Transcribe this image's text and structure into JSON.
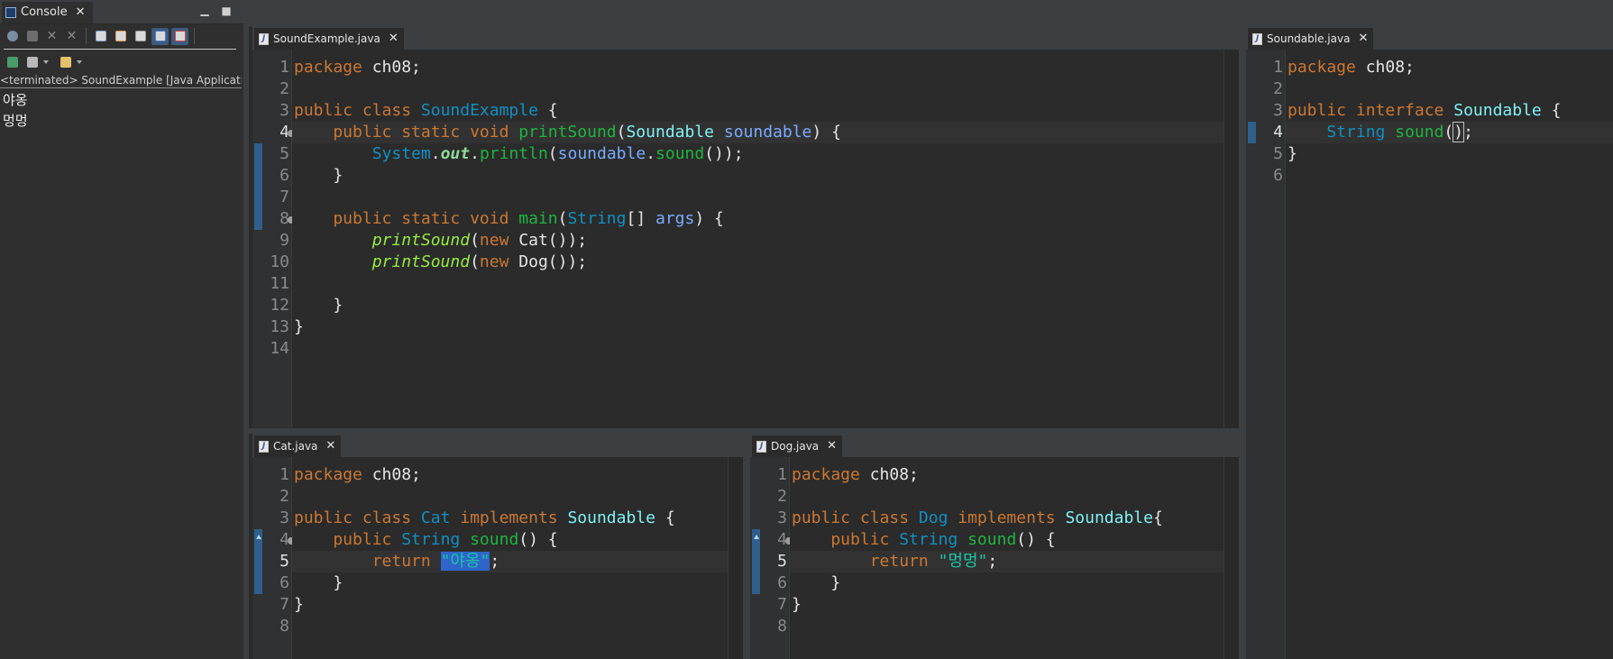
{
  "console": {
    "tab_label": "Console",
    "status": "<terminated> SoundExample [Java Application] C",
    "output": [
      "야옹",
      "멍멍"
    ],
    "toolbar": {
      "row1": [
        "relaunch-icon",
        "terminate-icon",
        "remove-launch-icon",
        "remove-all-terminated-icon",
        "clear-console-icon",
        "scroll-lock-icon",
        "word-wrap-icon",
        "show-stdout-icon",
        "show-stderr-icon"
      ],
      "row2": [
        "pin-console-icon",
        "display-selected-console-icon",
        "open-console-icon"
      ]
    }
  },
  "editors": {
    "sound_example": {
      "tab_label": "SoundExample.java",
      "line_numbers": [
        "1",
        "2",
        "3",
        "4",
        "5",
        "6",
        "7",
        "8",
        "9",
        "10",
        "11",
        "12",
        "13",
        "14"
      ],
      "tokens": {
        "l1": [
          "package",
          " ch08;"
        ],
        "l3": [
          "public class ",
          "SoundExample",
          " {"
        ],
        "l4": [
          "    public static void ",
          "printSound",
          "(",
          "Soundable",
          " ",
          "soundable",
          ") {"
        ],
        "l5": [
          "        ",
          "System",
          ".",
          "out",
          ".",
          "println",
          "(",
          "soundable",
          ".",
          "sound",
          "());"
        ],
        "l6": [
          "    }"
        ],
        "l8": [
          "    public static void ",
          "main",
          "(",
          "String",
          "[] ",
          "args",
          ") {"
        ],
        "l9": [
          "        ",
          "printSound",
          "(",
          "new",
          " Cat());"
        ],
        "l10": [
          "        ",
          "printSound",
          "(",
          "new",
          " Dog());"
        ],
        "l12": [
          "    }"
        ],
        "l13": [
          "}"
        ]
      }
    },
    "soundable": {
      "tab_label": "Soundable.java",
      "line_numbers": [
        "1",
        "2",
        "3",
        "4",
        "5",
        "6"
      ],
      "tokens": {
        "l1": [
          "package",
          " ch08;"
        ],
        "l3": [
          "public interface ",
          "Soundable",
          " {"
        ],
        "l4": [
          "    ",
          "String",
          " ",
          "sound",
          "(",
          ")",
          ";"
        ],
        "l5": [
          "}"
        ]
      }
    },
    "cat": {
      "tab_label": "Cat.java",
      "line_numbers": [
        "1",
        "2",
        "3",
        "4",
        "5",
        "6",
        "7",
        "8"
      ],
      "tokens": {
        "l1": [
          "package",
          " ch08;"
        ],
        "l3": [
          "public class ",
          "Cat",
          " implements ",
          "Soundable",
          " {"
        ],
        "l4": [
          "    public ",
          "String",
          " ",
          "sound",
          "() {"
        ],
        "l5": [
          "        return ",
          "\"야옹\"",
          ";"
        ],
        "l6": [
          "    }"
        ],
        "l7": [
          "}"
        ]
      }
    },
    "dog": {
      "tab_label": "Dog.java",
      "line_numbers": [
        "1",
        "2",
        "3",
        "4",
        "5",
        "6",
        "7",
        "8"
      ],
      "tokens": {
        "l1": [
          "package",
          " ch08;"
        ],
        "l3": [
          "public class ",
          "Dog",
          " implements ",
          "Soundable",
          "{"
        ],
        "l4": [
          "    public ",
          "String",
          " ",
          "sound",
          "() {"
        ],
        "l5": [
          "        return ",
          "\"멍멍\"",
          ";"
        ],
        "l6": [
          "    }"
        ],
        "l7": [
          "}"
        ]
      }
    }
  },
  "colors": {
    "keyword": "#cc7832",
    "class_name": "#1290c3",
    "type_ref": "#80f2f6",
    "method": "#1eb540",
    "static_call": "#96ec3f",
    "local_var": "#79abff",
    "string": "#17c6a3",
    "selection": "#2f65ca"
  }
}
